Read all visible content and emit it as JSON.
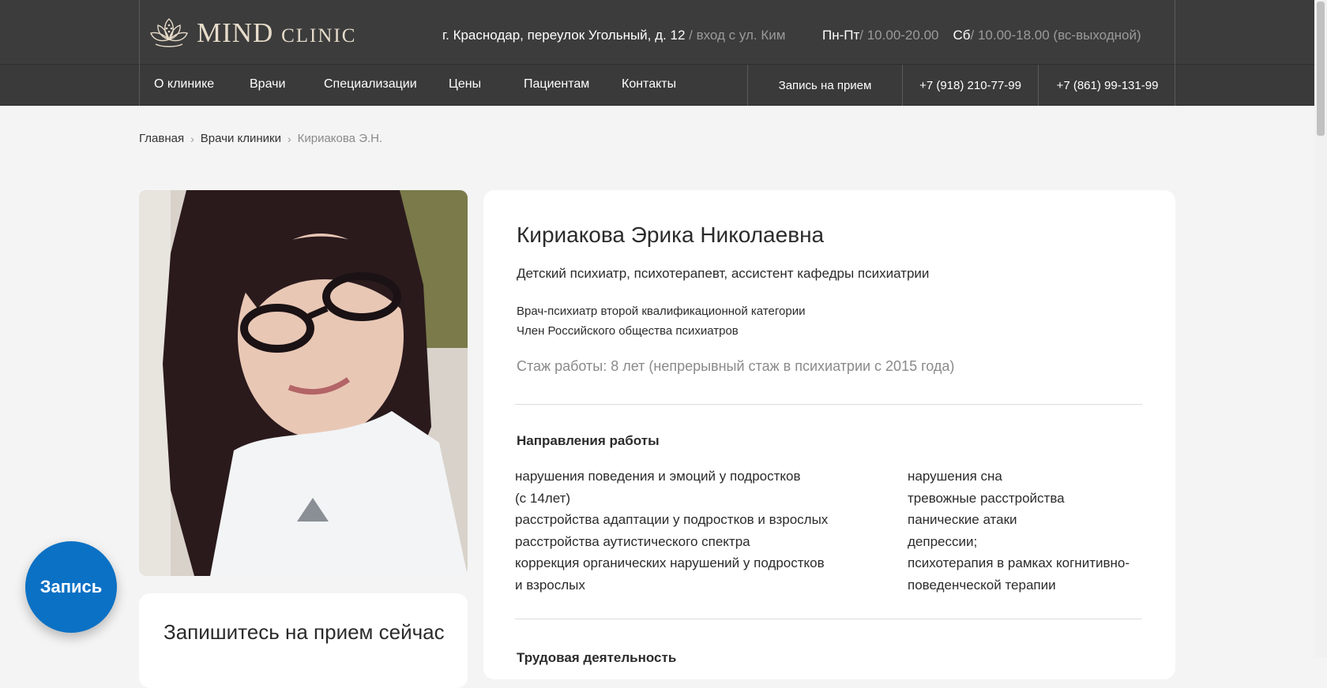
{
  "header": {
    "logo_main": "MIND",
    "logo_sub": "CLINIC",
    "address": "г. Краснодар, переулок Угольный, д. 12",
    "address_note": " / вход с ул. Ким",
    "weekdays_label": "Пн-Пт",
    "weekdays_hours": "/ 10.00-20.00",
    "saturday_label": "Сб",
    "saturday_hours": "/ 10.00-18.00 (вс-выходной)"
  },
  "nav": {
    "items": [
      "О клинике",
      "Врачи",
      "Специализации",
      "Цены",
      "Пациентам",
      "Контакты"
    ],
    "appointment": "Запись на прием",
    "phone1": "+7 (918) 210-77-99",
    "phone2": "+7 (861) 99-131-99"
  },
  "breadcrumb": {
    "home": "Главная",
    "doctors": "Врачи клиники",
    "current": "Кириакова Э.Н."
  },
  "doctor": {
    "name": "Кириакова Эрика Николаевна",
    "role": "Детский психиатр, психотерапевт, ассистент кафедры психиатрии",
    "credential1": "Врач-психиатр второй квалификационной категории",
    "credential2": "Член Российского общества психиатров",
    "experience": "Стаж работы: 8 лет (непрерывный стаж в психиатрии с 2015 года)"
  },
  "directions": {
    "title": "Направления работы",
    "left": [
      "нарушения поведения и эмоций у подростков",
      "(с 14лет)",
      "расстройства адаптации у подростков и взрослых",
      "расстройства аутистического спектра",
      "коррекция органических нарушений у подростков",
      "и взрослых"
    ],
    "right": [
      "нарушения сна",
      "тревожные расстройства",
      "панические атаки",
      "депрессии;",
      "психотерапия в рамках когнитивно-",
      "поведенческой терапии"
    ]
  },
  "next_section_title": "Трудовая деятельность",
  "booking_card_title": "Запишитесь на прием сейчас",
  "fab_label": "Запись",
  "colors": {
    "header_bg": "#3c3c3c",
    "logo_gold": "#e7dccb",
    "fab_blue": "#0b71c5",
    "page_bg": "#f4f4f4"
  }
}
